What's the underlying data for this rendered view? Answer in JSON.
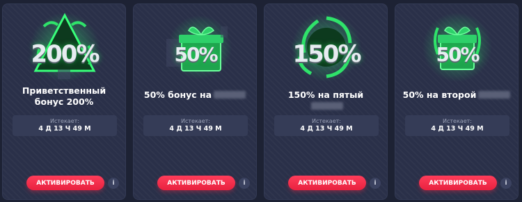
{
  "colors": {
    "background": "#1d2234",
    "card": "#2a3049",
    "button": "#ff3d5a",
    "expiry_box": "#353c57",
    "glow": "#2fe36a"
  },
  "cards": [
    {
      "art_icon": "pyramid-200-percent-icon",
      "art_text": "200%",
      "title": "Приветственный бонус 200%",
      "expiry_label": "Истекает:",
      "expiry_value": "4 Д 13 Ч 49 М",
      "button_label": "АКТИВИРОВАТЬ",
      "info_label": "i"
    },
    {
      "art_icon": "gift-box-50-percent-icon",
      "art_text": "50%",
      "title": "50% бонус на",
      "expiry_label": "Истекает:",
      "expiry_value": "4 Д 13 Ч 49 М",
      "button_label": "АКТИВИРОВАТЬ",
      "info_label": "i"
    },
    {
      "art_icon": "spiral-150-percent-icon",
      "art_text": "150%",
      "title": "150% на пятый",
      "expiry_label": "Истекает:",
      "expiry_value": "4 Д 13 Ч 49 М",
      "button_label": "АКТИВИРОВАТЬ",
      "info_label": "i"
    },
    {
      "art_icon": "gift-box-50-percent-icon",
      "art_text": "50%",
      "title": "50% на второй",
      "expiry_label": "Истекает:",
      "expiry_value": "4 Д 13 Ч 49 М",
      "button_label": "АКТИВИРОВАТЬ",
      "info_label": "i"
    }
  ]
}
